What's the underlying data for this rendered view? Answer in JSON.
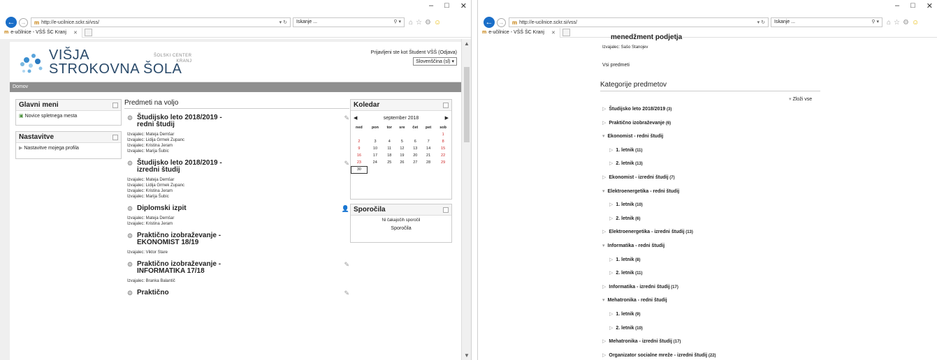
{
  "browser": {
    "url": "http://e-ucilnice.sckr.si/vss/",
    "search_placeholder": "Iskanje ...",
    "tab_title": "e-učilnice - VŠŠ ŠC Kranj"
  },
  "left_window": {
    "logo_line1": "VIŠJA",
    "logo_line2": "STROKOVNA ŠOLA",
    "school_line1": "ŠOLSKI CENTER",
    "school_line2": "KRANJ",
    "login_text": "Prijavljeni ste kot Študent VŠŠ (Odjava)",
    "language": "Slovenščina (sl)",
    "breadcrumb": "Domov",
    "main_menu_title": "Glavni meni",
    "main_menu_item": "Novice spletnega mesta",
    "settings_title": "Nastavitve",
    "settings_item": "Nastavitve mojega profila",
    "courses_title": "Predmeti na voljo",
    "courses": [
      {
        "name": "Študijsko leto 2018/2019 - redni študij",
        "teachers": [
          "Izvajalec: Mateja Demšar",
          "Izvajalec: Lidija Grmek Zupanc",
          "Izvajalec: Kristina Jeram",
          "Izvajalec: Marija Šubic"
        ]
      },
      {
        "name": "Študijsko leto 2018/2019 - izredni študij",
        "teachers": [
          "Izvajalec: Mateja Demšar",
          "Izvajalec: Lidija Grmek Zupanc",
          "Izvajalec: Kristina Jeram",
          "Izvajalec: Marija Šubic"
        ]
      },
      {
        "name": "Diplomski izpit",
        "teachers": [
          "Izvajalec: Mateja Demšar",
          "Izvajalec: Kristina Jeram"
        ]
      },
      {
        "name": "Praktično izobraževanje - EKONOMIST 18/19",
        "teachers": [
          "Izvajalec: Viktor Stare"
        ]
      },
      {
        "name": "Praktično izobraževanje - INFORMATIKA 17/18",
        "teachers": [
          "Izvajalec: Branka Balantič"
        ]
      },
      {
        "name": "Praktično",
        "teachers": []
      }
    ],
    "calendar_title": "Koledar",
    "calendar_month": "september 2018",
    "calendar_days": [
      "ned",
      "pon",
      "tor",
      "sre",
      "čet",
      "pet",
      "sob"
    ],
    "calendar_weeks": [
      [
        "",
        "",
        "",
        "",
        "",
        "",
        "1"
      ],
      [
        "2",
        "3",
        "4",
        "5",
        "6",
        "7",
        "8"
      ],
      [
        "9",
        "10",
        "11",
        "12",
        "13",
        "14",
        "15"
      ],
      [
        "16",
        "17",
        "18",
        "19",
        "20",
        "21",
        "22"
      ],
      [
        "23",
        "24",
        "25",
        "26",
        "27",
        "28",
        "29"
      ],
      [
        "30",
        "",
        "",
        "",
        "",
        "",
        ""
      ]
    ],
    "messages_title": "Sporočila",
    "messages_empty": "Ni čakajočih sporočil",
    "messages_link": "Sporočila"
  },
  "right_window": {
    "cut_course": "menedžment podjetja",
    "cut_teacher": "Izvajalec: Sašo Stanojev",
    "all_courses": "Vsi predmeti",
    "categories_title": "Kategorije predmetov",
    "collapse_all": "Zloži vse",
    "categories": [
      {
        "label": "Študijsko leto 2018/2019",
        "count": "(3)",
        "level": 0,
        "open": false
      },
      {
        "label": "Praktično izobraževanje",
        "count": "(6)",
        "level": 0,
        "open": false
      },
      {
        "label": "Ekonomist - redni študij",
        "count": "",
        "level": 0,
        "open": true
      },
      {
        "label": "1. letnik",
        "count": "(11)",
        "level": 1,
        "open": false
      },
      {
        "label": "2. letnik",
        "count": "(13)",
        "level": 1,
        "open": false
      },
      {
        "label": "Ekonomist - izredni študij",
        "count": "(7)",
        "level": 0,
        "open": false
      },
      {
        "label": "Elektroenergetika - redni študij",
        "count": "",
        "level": 0,
        "open": true
      },
      {
        "label": "1. letnik",
        "count": "(10)",
        "level": 1,
        "open": false
      },
      {
        "label": "2. letnik",
        "count": "(6)",
        "level": 1,
        "open": false
      },
      {
        "label": "Elektroenergetika - izredni študij",
        "count": "(13)",
        "level": 0,
        "open": false
      },
      {
        "label": "Informatika - redni študij",
        "count": "",
        "level": 0,
        "open": true
      },
      {
        "label": "1. letnik",
        "count": "(8)",
        "level": 1,
        "open": false
      },
      {
        "label": "2. letnik",
        "count": "(11)",
        "level": 1,
        "open": false
      },
      {
        "label": "Informatika - izredni študij",
        "count": "(17)",
        "level": 0,
        "open": false
      },
      {
        "label": "Mehatronika - redni študij",
        "count": "",
        "level": 0,
        "open": true
      },
      {
        "label": "1. letnik",
        "count": "(9)",
        "level": 1,
        "open": false
      },
      {
        "label": "2. letnik",
        "count": "(10)",
        "level": 1,
        "open": false
      },
      {
        "label": "Mehatronika - izredni študij",
        "count": "(17)",
        "level": 0,
        "open": false
      },
      {
        "label": "Organizator socialne mreže - izredni študij",
        "count": "(22)",
        "level": 0,
        "open": false
      }
    ]
  }
}
